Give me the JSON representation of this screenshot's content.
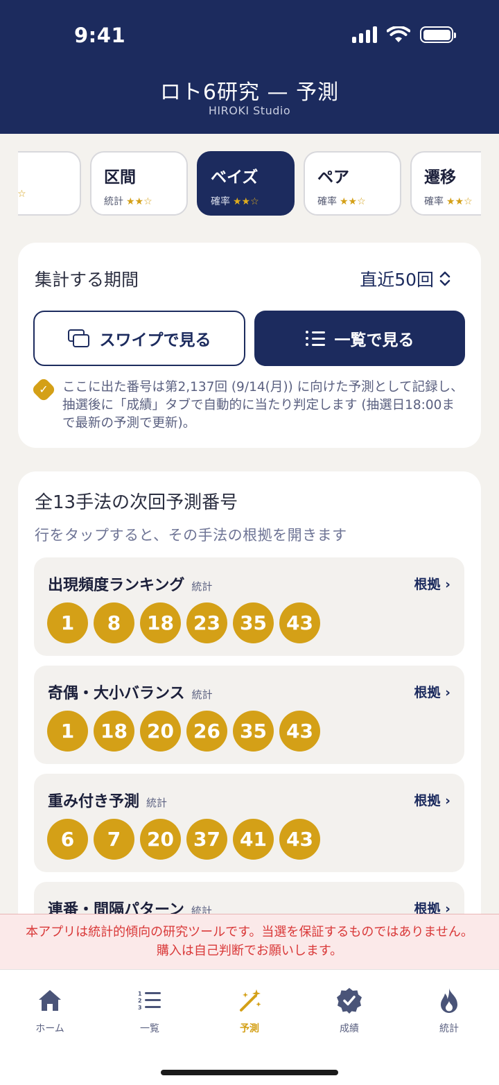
{
  "status_bar": {
    "time": "9:41"
  },
  "header": {
    "title": "ロト6研究 — 予測",
    "subtitle": "HIROKI Studio"
  },
  "chips": [
    {
      "name": "",
      "category": "",
      "stars": "★★☆",
      "active": false
    },
    {
      "name": "区間",
      "category": "統計",
      "stars": "★★☆",
      "active": false
    },
    {
      "name": "ベイズ",
      "category": "確率",
      "stars": "★★☆",
      "active": true
    },
    {
      "name": "ペア",
      "category": "確率",
      "stars": "★★☆",
      "active": false
    },
    {
      "name": "遷移",
      "category": "確率",
      "stars": "★★☆",
      "active": false
    }
  ],
  "period": {
    "label": "集計する期間",
    "selected": "直近50回",
    "swipe_label": "スワイプで見る",
    "list_label": "一覧で見る",
    "note": "ここに出た番号は第2,137回 (9/14(月)) に向けた予測として記録し、抽選後に「成績」タブで自動的に当たり判定します (抽選日18:00まで最新の予測で更新)。"
  },
  "methods": {
    "title": "全13手法の次回予測番号",
    "subtitle": "行をタップすると、その手法の根拠を開きます",
    "link_label": "根拠 ›",
    "rows": [
      {
        "name": "出現頻度ランキング",
        "tag": "統計",
        "numbers": [
          "1",
          "8",
          "18",
          "23",
          "35",
          "43"
        ]
      },
      {
        "name": "奇偶・大小バランス",
        "tag": "統計",
        "numbers": [
          "1",
          "18",
          "20",
          "26",
          "35",
          "43"
        ]
      },
      {
        "name": "重み付き予測",
        "tag": "統計",
        "numbers": [
          "6",
          "7",
          "20",
          "37",
          "41",
          "43"
        ]
      },
      {
        "name": "連番・間隔パターン",
        "tag": "統計",
        "numbers": []
      }
    ]
  },
  "disclaimer": "本アプリは統計的傾向の研究ツールです。当選を保証するものではありません。購入は自己判断でお願いします。",
  "tabs": [
    {
      "label": "ホーム",
      "icon": "home-icon"
    },
    {
      "label": "一覧",
      "icon": "numbered-list-icon"
    },
    {
      "label": "予測",
      "icon": "magic-wand-icon",
      "active": true
    },
    {
      "label": "成績",
      "icon": "verified-badge-icon"
    },
    {
      "label": "統計",
      "icon": "flame-icon"
    }
  ],
  "colors": {
    "navy": "#1c2b5e",
    "gold": "#d4a017",
    "warning": "#d93838"
  }
}
